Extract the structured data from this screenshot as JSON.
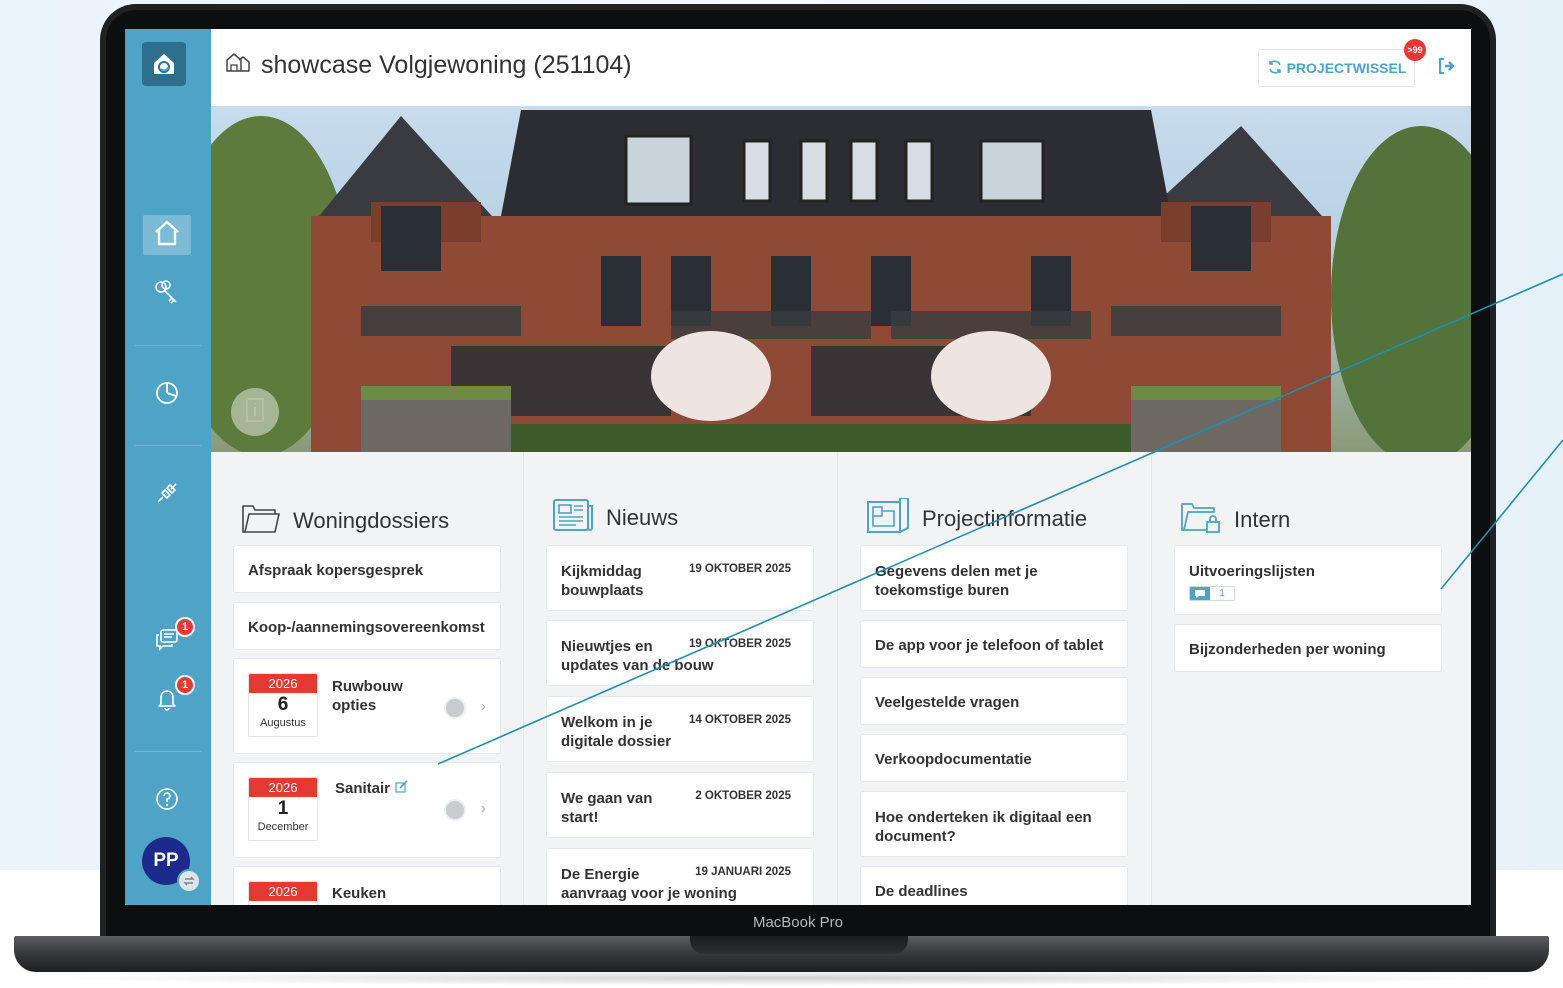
{
  "device": {
    "label": "MacBook Pro"
  },
  "sidebar": {
    "logo_icon": "house-logo-icon",
    "items": [
      {
        "name": "home",
        "icon": "home-icon",
        "active": true
      },
      {
        "name": "keys",
        "icon": "keys-icon"
      },
      {
        "name": "chart",
        "icon": "pie-chart-icon"
      },
      {
        "name": "connect",
        "icon": "plug-icon"
      },
      {
        "name": "messages",
        "icon": "chat-icon",
        "badge": "1"
      },
      {
        "name": "notifications",
        "icon": "bell-icon",
        "badge": "1"
      },
      {
        "name": "help",
        "icon": "question-icon"
      }
    ],
    "avatar": "PP"
  },
  "topbar": {
    "project_title": "showcase Volgjewoning (251104)",
    "project_switch_label": "PROJECTWISSEL",
    "project_switch_badge": ">99"
  },
  "columns": {
    "woningdossiers": {
      "title": "Woningdossiers",
      "items": [
        {
          "label": "Afspraak kopersgesprek"
        },
        {
          "label": "Koop-/aannemingsovereenkomst"
        }
      ],
      "options": [
        {
          "year": "2026",
          "day": "6",
          "month": "Augustus",
          "label_line1": "Ruwbouw",
          "label_line2": "opties"
        },
        {
          "year": "2026",
          "day": "1",
          "month": "December",
          "label_line1": "Sanitair",
          "label_line2": ""
        },
        {
          "year": "2026",
          "day": "",
          "month": "",
          "label_line1": "Keuken",
          "label_line2": ""
        }
      ]
    },
    "nieuws": {
      "title": "Nieuws",
      "items": [
        {
          "line1": "Kijkmiddag",
          "line2": "bouwplaats",
          "date": "19 OKTOBER 2025"
        },
        {
          "line1": "Nieuwtjes en",
          "line2": "updates van de bouw",
          "date": "19 OKTOBER 2025"
        },
        {
          "line1": "Welkom in je",
          "line2": "digitale dossier",
          "date": "14 OKTOBER 2025"
        },
        {
          "line1": "We gaan van",
          "line2": "start!",
          "date": "2 OKTOBER 2025"
        },
        {
          "line1": "De Energie",
          "line2": "aanvraag voor je woning",
          "date": "19 JANUARI 2025"
        }
      ]
    },
    "projectinformatie": {
      "title": "Projectinformatie",
      "items": [
        {
          "line1": "Gegevens delen met je",
          "line2": "toekomstige buren"
        },
        {
          "line1": "De app voor je telefoon of tablet",
          "line2": ""
        },
        {
          "line1": "Veelgestelde vragen",
          "line2": ""
        },
        {
          "line1": "Verkoopdocumentatie",
          "line2": ""
        },
        {
          "line1": "Hoe onderteken ik digitaal een",
          "line2": "document?"
        },
        {
          "line1": "De deadlines",
          "line2": ""
        }
      ]
    },
    "intern": {
      "title": "Intern",
      "items": [
        {
          "label": "Uitvoeringslijsten",
          "message_count": "1"
        },
        {
          "label": "Bijzonderheden per woning"
        }
      ]
    }
  },
  "colors": {
    "sidebar": "#4fa3c6",
    "accent": "#4fa3c6",
    "calendar_red": "#e53935",
    "avatar_bg": "#1c2a8c",
    "callout_line": "#1c8fb3"
  }
}
